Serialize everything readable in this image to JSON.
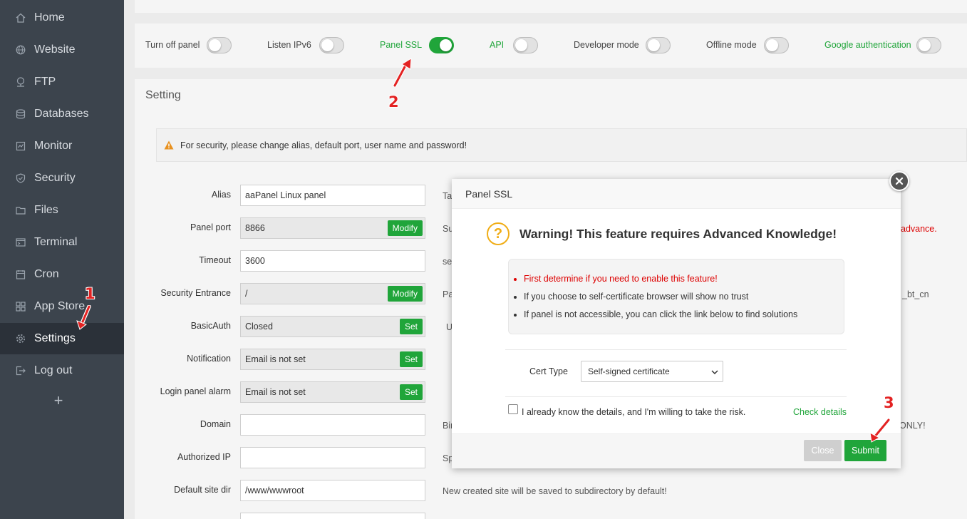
{
  "sidebar": {
    "items": [
      {
        "label": "Home",
        "icon": "home-icon"
      },
      {
        "label": "Website",
        "icon": "globe-icon"
      },
      {
        "label": "FTP",
        "icon": "ftp-icon"
      },
      {
        "label": "Databases",
        "icon": "database-icon"
      },
      {
        "label": "Monitor",
        "icon": "monitor-icon"
      },
      {
        "label": "Security",
        "icon": "shield-icon"
      },
      {
        "label": "Files",
        "icon": "folder-icon"
      },
      {
        "label": "Terminal",
        "icon": "terminal-icon"
      },
      {
        "label": "Cron",
        "icon": "clock-icon"
      },
      {
        "label": "App Store",
        "icon": "grid-icon"
      },
      {
        "label": "Settings",
        "icon": "gear-icon",
        "active": true
      },
      {
        "label": "Log out",
        "icon": "logout-icon"
      }
    ],
    "add_label": "+"
  },
  "toggles": [
    {
      "label": "Turn off panel",
      "on": false
    },
    {
      "label": "Listen IPv6",
      "on": false
    },
    {
      "label": "Panel SSL",
      "on": true
    },
    {
      "label": "API",
      "on": false
    },
    {
      "label": "Developer mode",
      "on": false
    },
    {
      "label": "Offline mode",
      "on": false
    },
    {
      "label": "Google authentication",
      "on": false
    }
  ],
  "setting": {
    "title": "Setting",
    "alert": "For security, please change alias, default port, user name and password!",
    "fields": [
      {
        "label": "Alias",
        "value": "aaPanel Linux panel",
        "button": "",
        "desc": "Ta"
      },
      {
        "label": "Panel port",
        "value": "8866",
        "button": "Modify",
        "desc": "Su",
        "desc_right": "advance."
      },
      {
        "label": "Timeout",
        "value": "3600",
        "button": "",
        "desc": "se"
      },
      {
        "label": "Security Entrance",
        "value": "/",
        "button": "Modify",
        "desc": "Pa",
        "desc_right": "_bt_cn"
      },
      {
        "label": "BasicAuth",
        "value": "Closed",
        "button": "Set",
        "desc": "U"
      },
      {
        "label": "Notification",
        "value": "Email is not set",
        "button": "Set",
        "desc": ""
      },
      {
        "label": "Login panel alarm",
        "value": "Email is not set",
        "button": "Set",
        "desc": ""
      },
      {
        "label": "Domain",
        "value": "",
        "button": "",
        "desc": "Bir",
        "desc_right": "ONLY!"
      },
      {
        "label": "Authorized IP",
        "value": "",
        "button": "",
        "desc": "Sp"
      },
      {
        "label": "Default site dir",
        "value": "/www/wwwroot",
        "button": "",
        "desc": "New created site will be saved to subdirectory by default!"
      }
    ]
  },
  "modal": {
    "title": "Panel SSL",
    "warning_title": "Warning! This feature requires Advanced Knowledge!",
    "warning_icon": "?",
    "notices": [
      {
        "text": "First determine if you need to enable this feature!",
        "red": true
      },
      {
        "text": "If you choose to self-certificate browser will show no trust",
        "red": false
      },
      {
        "text": "If panel is not accessible, you can click the link below to find solutions",
        "red": false
      }
    ],
    "cert_type_label": "Cert Type",
    "cert_type_value": "Self-signed certificate",
    "agree_label": "I already know the details, and I'm willing to take the risk.",
    "check_details": "Check details",
    "close_label": "Close",
    "submit_label": "Submit"
  },
  "annotations": {
    "step1": "1",
    "step2": "2",
    "step3": "3"
  },
  "colors": {
    "accent": "#20a53a",
    "sidebar_bg": "#3c444d",
    "warning": "#f0ad16",
    "danger": "#d00000",
    "annotation": "#e32222"
  }
}
